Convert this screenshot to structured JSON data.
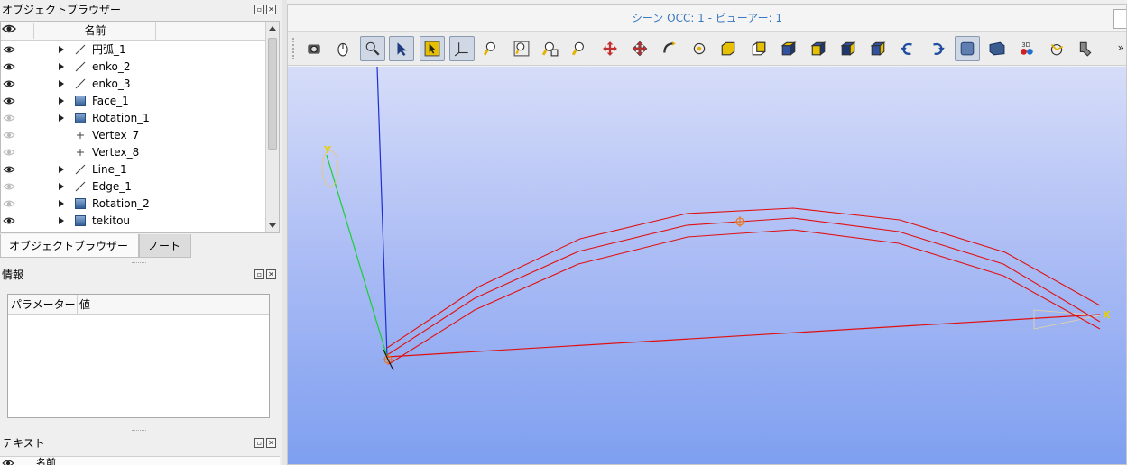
{
  "object_browser": {
    "title": "オブジェクトブラウザー",
    "column_name": "名前",
    "items": [
      {
        "label": "円弧_1",
        "type": "edge",
        "visible": true
      },
      {
        "label": "enko_2",
        "type": "edge",
        "visible": true
      },
      {
        "label": "enko_3",
        "type": "edge",
        "visible": true
      },
      {
        "label": "Face_1",
        "type": "solid",
        "visible": true
      },
      {
        "label": "Rotation_1",
        "type": "solid",
        "visible": false
      },
      {
        "label": "Vertex_7",
        "type": "vertex",
        "visible": false
      },
      {
        "label": "Vertex_8",
        "type": "vertex",
        "visible": false
      },
      {
        "label": "Line_1",
        "type": "edge",
        "visible": true
      },
      {
        "label": "Edge_1",
        "type": "edge",
        "visible": false
      },
      {
        "label": "Rotation_2",
        "type": "solid",
        "visible": false
      },
      {
        "label": "tekitou",
        "type": "solid",
        "visible": true
      }
    ]
  },
  "tabs": [
    {
      "label": "オブジェクトブラウザー",
      "active": true
    },
    {
      "label": "ノート",
      "active": false
    }
  ],
  "info": {
    "title": "情報",
    "col_param": "パラメーター",
    "col_value": "値"
  },
  "text_panel": {
    "title": "テキスト",
    "column_name": "名前"
  },
  "viewer": {
    "title": "シーン OCC: 1 - ビューアー: 1",
    "toolbar": [
      "dump-view-icon",
      "interaction-style-icon",
      "zoom-mode-icon",
      "select-icon",
      "rect-select-icon",
      "trihedron-icon",
      "zoom-icon",
      "fit-all-icon",
      "fit-area-icon",
      "fit-selection-icon",
      "pan-icon",
      "global-pan-icon",
      "rotate-icon",
      "rotation-center-icon",
      "front-view-icon",
      "back-view-icon",
      "top-view-icon",
      "bottom-view-icon",
      "left-view-icon",
      "right-view-icon",
      "rotate-ccw-icon",
      "rotate-cw-icon",
      "shading-icon",
      "projection-icon",
      "stereo-icon",
      "graduated-axes-icon",
      "reset-view-icon"
    ],
    "axis_x": "X",
    "axis_y": "Y"
  },
  "colors": {
    "accent": "#3b79c0",
    "axis_x": "#e8d000",
    "geometry": "#e01010"
  }
}
